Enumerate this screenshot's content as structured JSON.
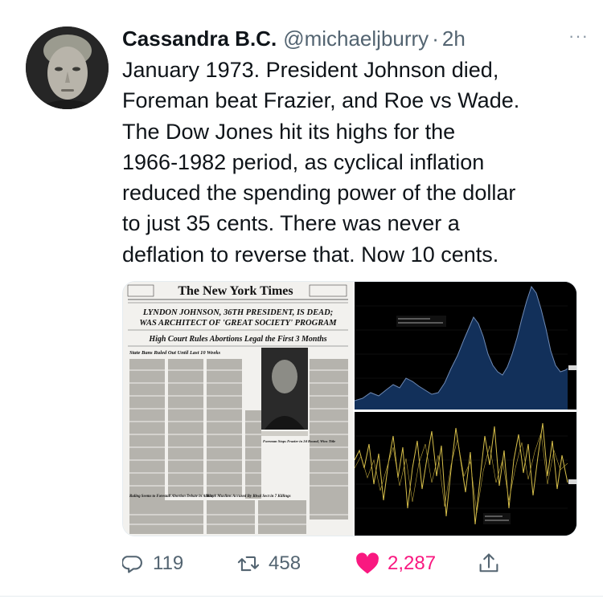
{
  "tweet": {
    "display_name": "Cassandra B.C.",
    "handle": "@michaeljburry",
    "separator": "·",
    "time": "2h",
    "more_label": "···",
    "text_lines": [
      "January 1973. President Johnson died,",
      "Foreman beat Frazier, and Roe vs Wade.",
      "The Dow Jones hit its highs for the",
      "1966-1982 period, as cyclical inflation",
      "reduced the spending power of the dollar",
      "to just 35 cents. There was never a",
      "deflation to reverse that. Now 10 cents."
    ]
  },
  "media": {
    "newspaper": {
      "masthead": "The New York Times",
      "headline_1": "LYNDON JOHNSON, 36TH PRESIDENT, IS DEAD;",
      "headline_2": "WAS ARCHITECT OF 'GREAT SOCIETY' PROGRAM",
      "subheadline": "High Court Rules Abortions Legal the First 3 Months",
      "left_column_head": "State Bans Ruled Out Until Last 10 Weeks",
      "photo_caption": "Foreman Stops Frazier in 2d Round, Wins Title",
      "bottom_left_head": "Ruling Seems to Forestall Abortion Debate in Albany",
      "bottom_mid_head": "Black Muslims Accused By Rival Sect in 7 Killings"
    },
    "chart_top": {
      "area_color": "#12305a",
      "line_color": "#6f8ab5",
      "background": "#000000"
    },
    "chart_bottom": {
      "line_color": "#d8c04a",
      "background": "#000000"
    }
  },
  "actions": {
    "reply_count": "119",
    "retweet_count": "458",
    "like_count": "2,287",
    "like_color": "#f91880",
    "icons": [
      "reply-icon",
      "retweet-icon",
      "heart-icon",
      "share-icon"
    ]
  }
}
